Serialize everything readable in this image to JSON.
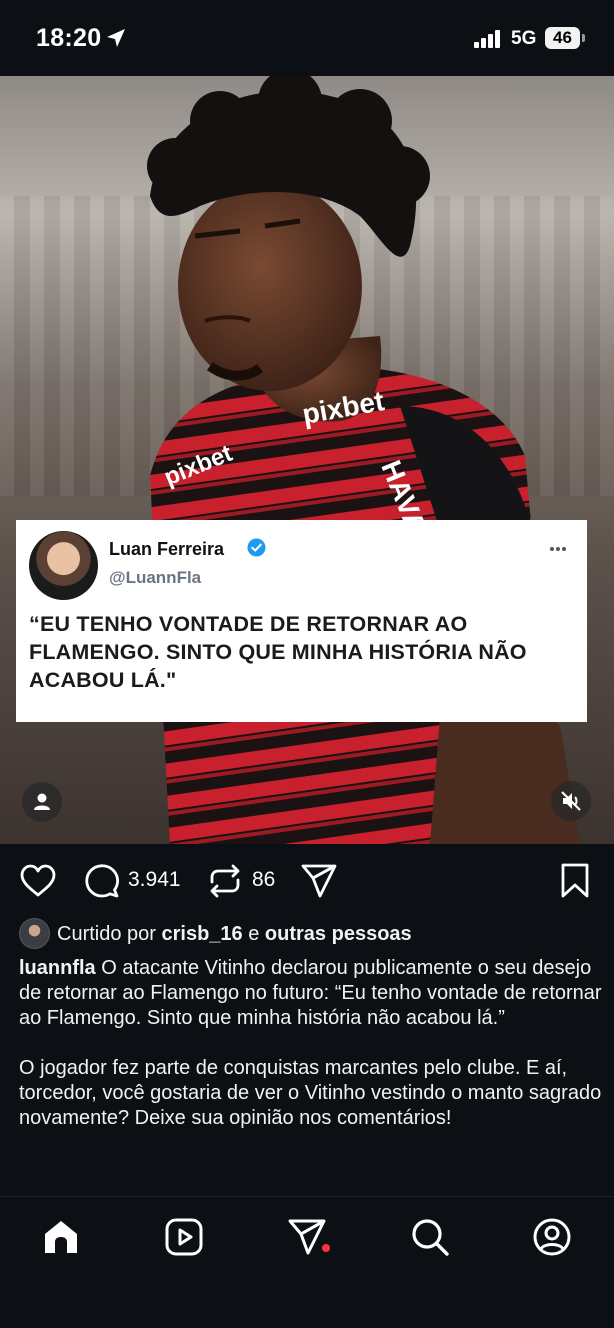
{
  "status_bar": {
    "time": "18:20",
    "network": "5G",
    "battery": "46"
  },
  "tweet": {
    "name": "Luan Ferreira",
    "handle": "@LuannFla",
    "quote": "“EU TENHO VONTADE DE RETORNAR AO FLAMENGO. SINTO QUE MINHA HISTÓRIA NÃO ACABOU LÁ.\""
  },
  "jersey_text": {
    "sponsor": "pixbet",
    "sleeve": "pixbet",
    "side": "HAVA"
  },
  "actions": {
    "comments": "3.941",
    "reposts": "86"
  },
  "likes": {
    "prefix": "Curtido por",
    "user": "crisb_16",
    "joiner": "e",
    "others": "outras pessoas"
  },
  "caption": {
    "username": "luannfla",
    "text1": "O atacante Vitinho declarou publicamente o seu desejo de retornar ao Flamengo no futuro: “Eu tenho vontade de retornar ao Flamengo. Sinto que minha história não acabou lá.”",
    "text2": "O jogador fez parte de conquistas marcantes pelo clube. E aí, torcedor, você gostaria de ver o Vitinho vestindo o manto sagrado novamente? Deixe sua opinião nos comentários!"
  },
  "colors": {
    "background": "#0c0f14",
    "verified": "#1d9bf0",
    "jersey_red": "#c8202c",
    "notification": "#ff3040"
  },
  "icons": [
    "location-arrow-icon",
    "signal-icon",
    "verified-icon",
    "more-icon",
    "user-icon",
    "mute-icon",
    "heart-icon",
    "comment-icon",
    "repost-icon",
    "share-icon",
    "bookmark-icon",
    "home-icon",
    "reels-icon",
    "direct-icon",
    "search-icon",
    "profile-icon"
  ]
}
